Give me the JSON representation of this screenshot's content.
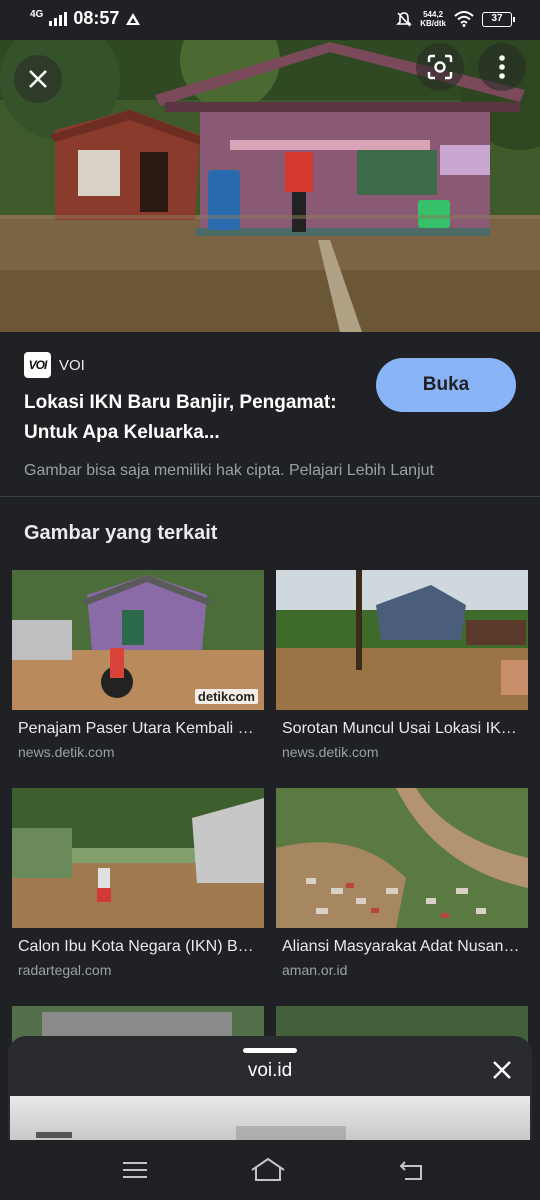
{
  "status_bar": {
    "network": "4G",
    "time": "08:57",
    "speed_value": "544,2",
    "speed_unit": "KB/dtk",
    "battery": "37"
  },
  "source": {
    "logo_text": "VOI",
    "name": "VOI"
  },
  "result": {
    "title": "Lokasi IKN Baru Banjir, Pengamat: Untuk Apa Keluarka...",
    "open_label": "Buka",
    "copyright": "Gambar bisa saja memiliki hak cipta. Pelajari Lebih Lanjut"
  },
  "related": {
    "heading": "Gambar yang terkait",
    "items": [
      {
        "title": "Penajam Paser Utara Kembali Banjir",
        "domain": "news.detik.com",
        "watermark": "detikcom"
      },
      {
        "title": "Sorotan Muncul Usai Lokasi IKN Banjir",
        "domain": "news.detik.com"
      },
      {
        "title": "Calon Ibu Kota Negara (IKN) Banjir",
        "domain": "radartegal.com"
      },
      {
        "title": "Aliansi Masyarakat Adat Nusantara",
        "domain": "aman.or.id"
      }
    ]
  },
  "sheet": {
    "title": "voi.id"
  },
  "icons": {
    "close": "close-icon",
    "lens": "lens-icon",
    "more": "more-vert-icon",
    "menu": "menu-icon",
    "home": "home-icon",
    "back": "back-icon"
  }
}
